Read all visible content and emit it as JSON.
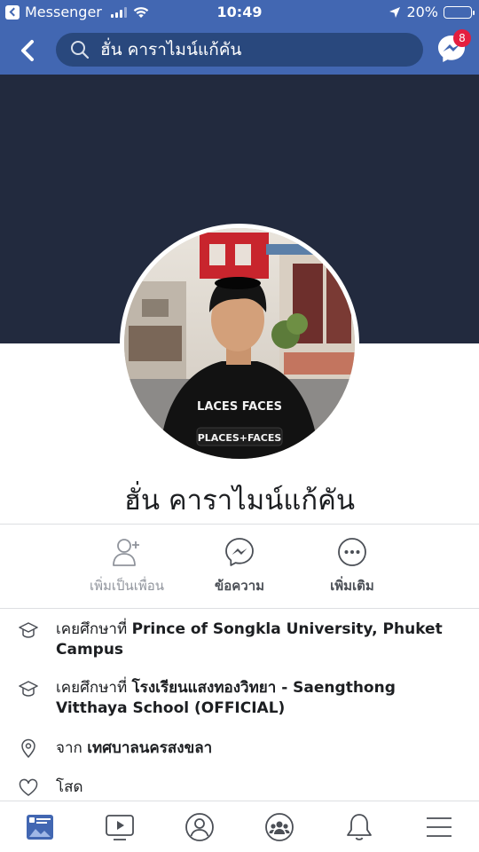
{
  "status_bar": {
    "back_app": "Messenger",
    "time": "10:49",
    "battery": "20%",
    "battery_level": 0.2
  },
  "nav": {
    "search_text": "ฮั่น คาราไมน์แก้คัน",
    "messenger_badge": "8"
  },
  "profile": {
    "name": "ฮั่น คาราไมน์แก้คัน"
  },
  "actions": {
    "add_friend": "เพิ่มเป็นเพื่อน",
    "message": "ข้อความ",
    "more": "เพิ่มเติม"
  },
  "info": {
    "edu1_prefix": "เคยศึกษาที่",
    "edu1_place": "Prince of Songkla University, Phuket Campus",
    "edu2_prefix": "เคยศึกษาที่",
    "edu2_place": "โรงเรียนแสงทองวิทยา - Saengthong Vitthaya School (OFFICIAL)",
    "from_prefix": "จาก",
    "from_place": "เทศบาลนครสงขลา",
    "relationship": "โสด"
  },
  "avatar": {
    "shirt_text": "LACES FACES",
    "bag_text": "PLACES+FACES"
  },
  "colors": {
    "header": "#4267b2",
    "search": "#29487d",
    "cover": "#222a3e",
    "badge": "#e41e3f",
    "tab_active": "#4267b2"
  },
  "tabs": [
    "news-feed",
    "watch",
    "profile",
    "groups",
    "notifications",
    "menu"
  ]
}
